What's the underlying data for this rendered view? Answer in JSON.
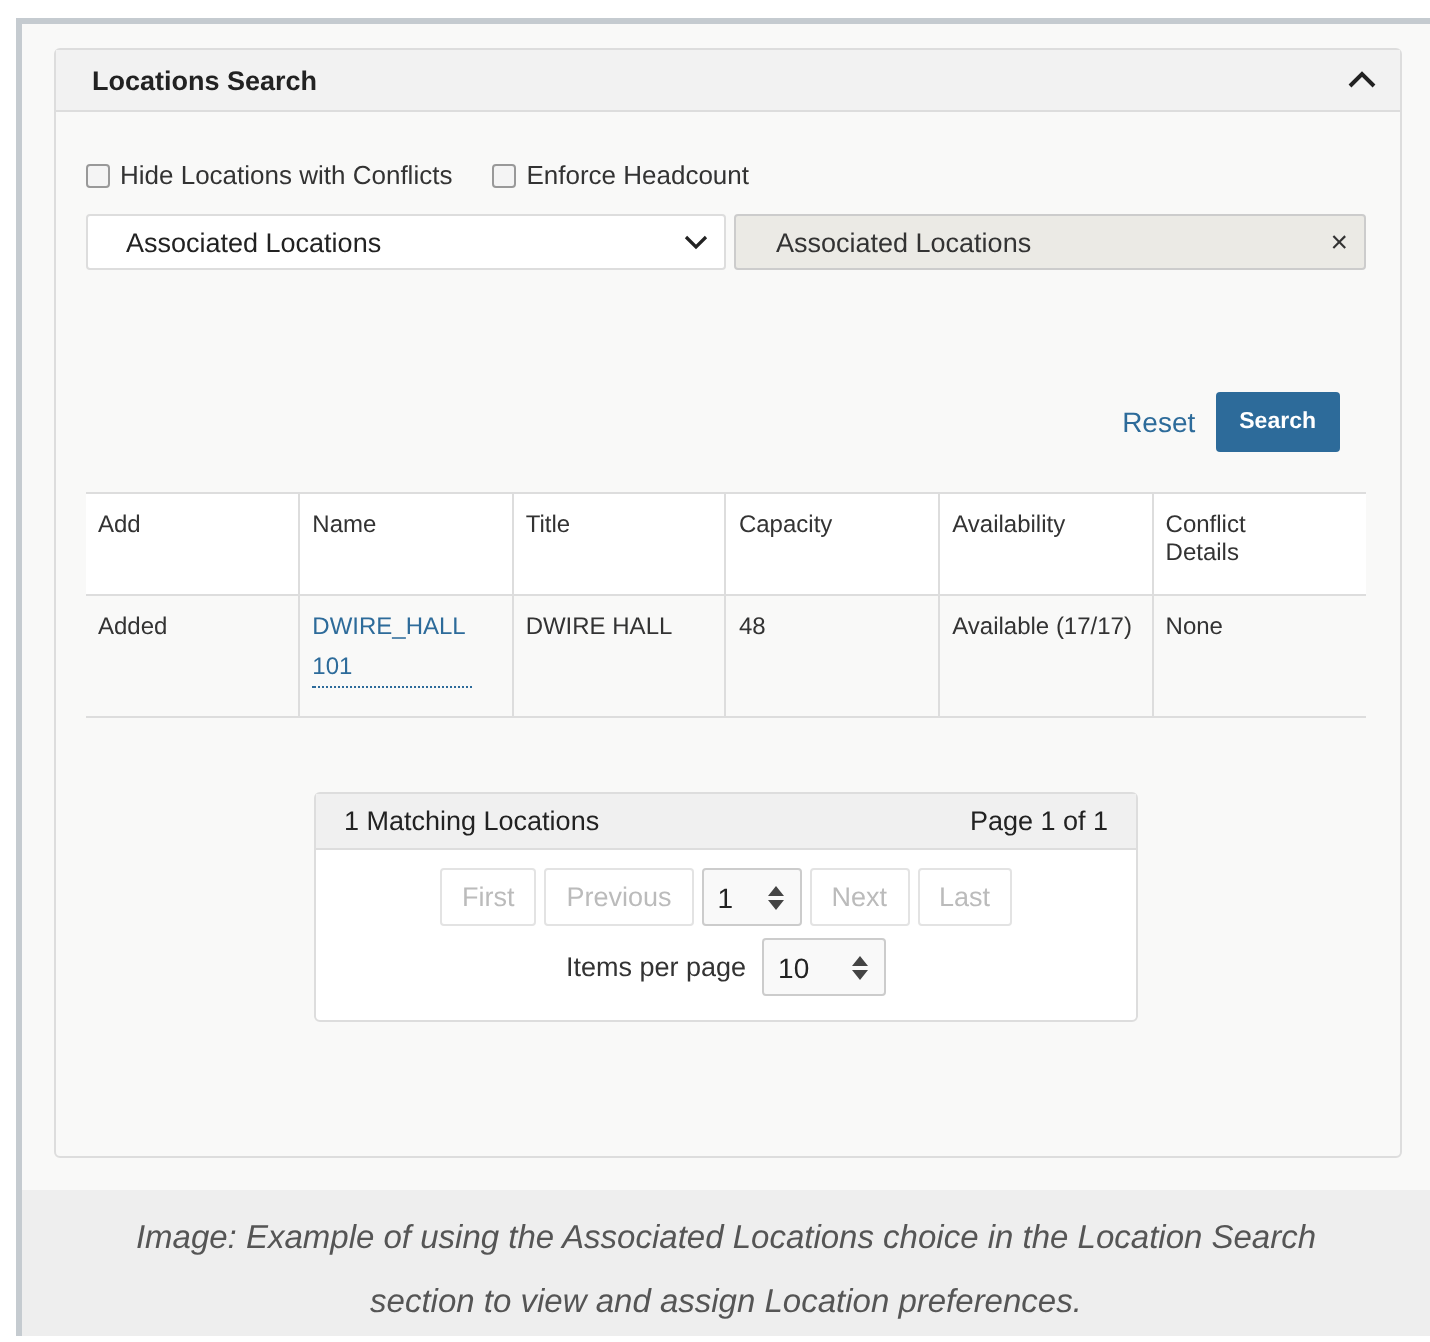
{
  "panel": {
    "title": "Locations Search",
    "expanded": true
  },
  "options": [
    {
      "label": "Hide Locations with Conflicts",
      "checked": false
    },
    {
      "label": "Enforce Headcount",
      "checked": false
    }
  ],
  "dropdown": {
    "value": "Associated Locations"
  },
  "tag": {
    "label": "Associated Locations",
    "close": "×"
  },
  "actions": {
    "reset": "Reset",
    "search": "Search"
  },
  "table": {
    "columns": [
      "Add",
      "Name",
      "Title",
      "Capacity",
      "Availability",
      "Conflict Details"
    ],
    "rows": [
      [
        "Added",
        "DWIRE_HALL 101",
        "DWIRE HALL",
        "48",
        "Available (17/17)",
        "None"
      ]
    ]
  },
  "pager": {
    "matches": "1 Matching Locations",
    "page_info": "Page 1 of 1",
    "buttons": [
      {
        "label": "First",
        "disabled": true
      },
      {
        "label": "Previous",
        "disabled": true
      }
    ],
    "page": "1",
    "buttons_after": [
      {
        "label": "Next",
        "disabled": true
      },
      {
        "label": "Last",
        "disabled": true
      }
    ],
    "items_label": "Items per page",
    "items_value": "10"
  },
  "caption": "Image: Example of using the Associated Locations choice in the Location Search section to view and assign Location preferences."
}
